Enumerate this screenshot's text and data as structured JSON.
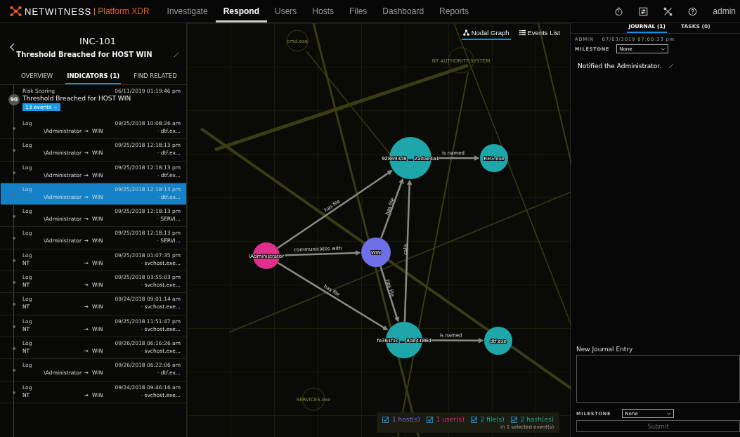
{
  "nav": {
    "brand": "NETWITNESS",
    "product": "Platform XDR",
    "items": [
      {
        "label": "Investigate",
        "selected": false
      },
      {
        "label": "Respond",
        "selected": true
      },
      {
        "label": "Users",
        "selected": false
      },
      {
        "label": "Hosts",
        "selected": false
      },
      {
        "label": "Files",
        "selected": false
      },
      {
        "label": "Dashboard",
        "selected": false
      },
      {
        "label": "Reports",
        "selected": false
      }
    ],
    "user": "admin"
  },
  "incident": {
    "id": "INC-101",
    "title": "Threshold Breached for HOST WIN",
    "tabs": [
      {
        "label": "OVERVIEW",
        "selected": false
      },
      {
        "label": "INDICATORS (1)",
        "selected": true
      },
      {
        "label": "FIND RELATED",
        "selected": false
      }
    ]
  },
  "indicator": {
    "source": "Risk Scoring",
    "time": "06/11/2019 01:19:46 pm",
    "title": "Threshold Breached for HOST WIN",
    "score": "90",
    "events": "13 events"
  },
  "events": [
    {
      "type": "Log",
      "time": "09/25/2018 10:08:26 am",
      "user": "\\Administrator",
      "host": "WIN",
      "file": "· dtf.ex...",
      "selected": false
    },
    {
      "type": "Log",
      "time": "09/25/2018 12:18:13 pm",
      "user": "\\Administrator",
      "host": "WIN",
      "file": "· dtf.ex...",
      "selected": false
    },
    {
      "type": "Log",
      "time": "09/25/2018 12:18:13 pm",
      "user": "\\Administrator",
      "host": "WIN",
      "file": "· dtf.ex...",
      "selected": false
    },
    {
      "type": "Log",
      "time": "09/25/2018 12:18:13 pm",
      "user": "\\Administrator",
      "host": "WIN",
      "file": "· dtf.ex...",
      "selected": true
    },
    {
      "type": "Log",
      "time": "09/25/2018 12:18:13 pm",
      "user": "\\Administrator",
      "host": "WIN",
      "file": "· SERVI...",
      "selected": false
    },
    {
      "type": "Log",
      "time": "09/25/2018 12:18:13 pm",
      "user": "\\Administrator",
      "host": "WIN",
      "file": "· SERVI...",
      "selected": false
    },
    {
      "type": "Log",
      "time": "09/25/2018 01:07:35 pm",
      "user": "NT",
      "host": "WIN",
      "file": "· svchost.exe...",
      "selected": false
    },
    {
      "type": "Log",
      "time": "09/25/2018 03:55:03 pm",
      "user": "NT",
      "host": "WIN",
      "file": "· svchost.exe...",
      "selected": false
    },
    {
      "type": "Log",
      "time": "09/24/2018 09:01:14 am",
      "user": "NT",
      "host": "WIN",
      "file": "· svchost.exe...",
      "selected": false
    },
    {
      "type": "Log",
      "time": "09/25/2018 11:51:47 pm",
      "user": "NT",
      "host": "WIN",
      "file": "· svchost.exe...",
      "selected": false
    },
    {
      "type": "Log",
      "time": "09/26/2018 06:16:26 am",
      "user": "NT",
      "host": "WIN",
      "file": "· svchost.exe...",
      "selected": false
    },
    {
      "type": "Log",
      "time": "09/26/2018 06:22:06 am",
      "user": "\\Administrator",
      "host": "WIN",
      "file": "· dtf.ex...",
      "selected": false
    },
    {
      "type": "Log",
      "time": "09/24/2018 09:46:16 am",
      "user": "NT",
      "host": "WIN",
      "file": "· svchost.exe...",
      "selected": false
    }
  ],
  "view_tabs": [
    {
      "label": "Nodal Graph",
      "kind": "graph",
      "selected": true
    },
    {
      "label": "Events List",
      "kind": "list",
      "selected": false
    }
  ],
  "graph": {
    "faded_nodes": [
      {
        "label": "cmd.exe"
      },
      {
        "label": "NT AUTHORITY\\SYSTEM"
      },
      {
        "label": "SERVICES.exe"
      }
    ],
    "nodes": [
      {
        "label": "928693d8 ... 2adae4a1",
        "kind": "hash"
      },
      {
        "label": "REG.exe",
        "kind": "file"
      },
      {
        "label": "\\Administrator",
        "kind": "user"
      },
      {
        "label": "WIN",
        "kind": "host"
      },
      {
        "label": "fe361f1c ... 8de4186d",
        "kind": "hash"
      },
      {
        "label": "dtf.exe",
        "kind": "file"
      }
    ],
    "edges": [
      {
        "label": "is named"
      },
      {
        "label": "has file"
      },
      {
        "label": "communicates with"
      },
      {
        "label": "has file"
      },
      {
        "label": "calls"
      },
      {
        "label": "has file"
      },
      {
        "label": "has file"
      },
      {
        "label": "is named"
      }
    ],
    "legend": [
      {
        "label": "1 host(s)",
        "kind": "host",
        "checked": true
      },
      {
        "label": "1 user(s)",
        "kind": "user",
        "checked": true
      },
      {
        "label": "2 file(s)",
        "kind": "file",
        "checked": true
      },
      {
        "label": "2 hash(es)",
        "kind": "hash",
        "checked": true
      }
    ],
    "legend_note": "in 1 selected event(s)"
  },
  "journal": {
    "tabs": [
      {
        "label": "JOURNAL (1)",
        "selected": true
      },
      {
        "label": "TASKS (0)",
        "selected": false
      }
    ],
    "entry": {
      "author": "ADMIN",
      "time": "07/03/2019 07:00:23 pm",
      "milestone_label": "MILESTONE",
      "milestone": "None",
      "text": "Notified the Administrator."
    },
    "new_entry": {
      "title": "New Journal Entry",
      "milestone_label": "MILESTONE",
      "milestone": "None",
      "submit": "Submit",
      "submit_disabled": true
    }
  }
}
